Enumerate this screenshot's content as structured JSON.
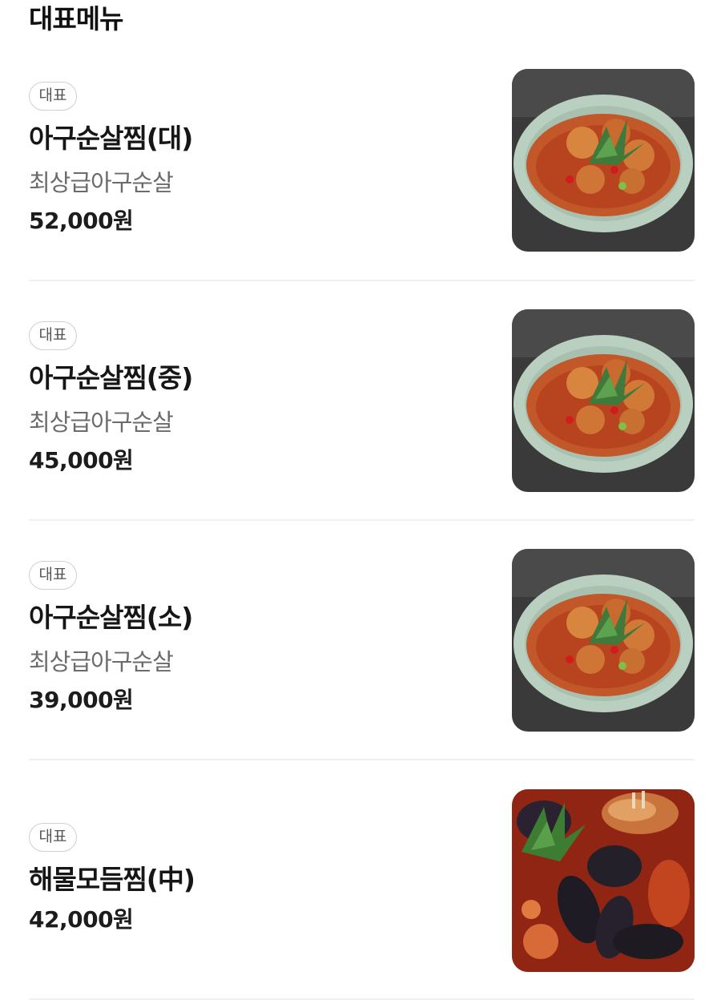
{
  "section_title": "대표메뉴",
  "items": [
    {
      "badge": "대표",
      "name": "아구순살찜(대)",
      "description": "최상급아구순살",
      "price": "52,000원",
      "image_icon": "braised-monkfish-plate-icon"
    },
    {
      "badge": "대표",
      "name": "아구순살찜(중)",
      "description": "최상급아구순살",
      "price": "45,000원",
      "image_icon": "braised-monkfish-plate-icon"
    },
    {
      "badge": "대표",
      "name": "아구순살찜(소)",
      "description": "최상급아구순살",
      "price": "39,000원",
      "image_icon": "braised-monkfish-plate-icon"
    },
    {
      "badge": "대표",
      "name": "해물모듬찜(中)",
      "price": "42,000원",
      "image_icon": "braised-seafood-icon"
    }
  ],
  "colors": {
    "badge_border": "#cfcfcf",
    "description_text": "#6b6b6b",
    "divider": "#f0f0f0"
  }
}
